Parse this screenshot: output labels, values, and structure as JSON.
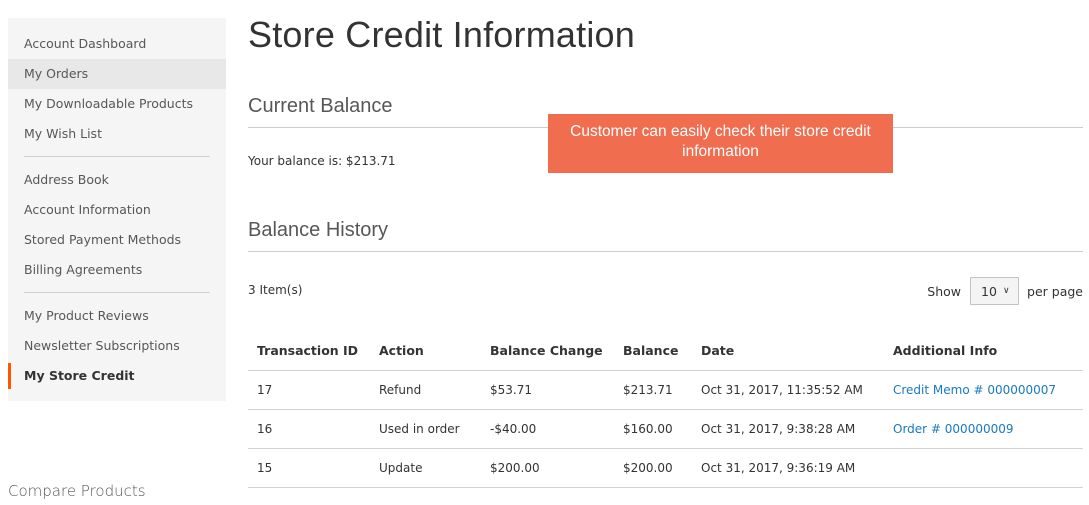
{
  "sidebar": {
    "groups": [
      {
        "items": [
          {
            "label": "Account Dashboard"
          },
          {
            "label": "My Orders"
          },
          {
            "label": "My Downloadable Products"
          },
          {
            "label": "My Wish List"
          }
        ]
      },
      {
        "items": [
          {
            "label": "Address Book"
          },
          {
            "label": "Account Information"
          },
          {
            "label": "Stored Payment Methods"
          },
          {
            "label": "Billing Agreements"
          }
        ]
      },
      {
        "items": [
          {
            "label": "My Product Reviews"
          },
          {
            "label": "Newsletter Subscriptions"
          },
          {
            "label": "My Store Credit"
          }
        ]
      }
    ],
    "hovered_item": "My Orders",
    "current_item": "My Store Credit",
    "accent_color": "#ff5501"
  },
  "compare": {
    "title": "Compare Products"
  },
  "page": {
    "title": "Store Credit Information"
  },
  "current_balance": {
    "title": "Current Balance",
    "text": "Your balance is: $213.71"
  },
  "callout": {
    "text": "Customer can easily check their store credit information",
    "color": "#f06d4f"
  },
  "history": {
    "title": "Balance History",
    "items_count": "3 Item(s)",
    "limiter": {
      "show_label": "Show",
      "selected": "10",
      "per_page_label": "per page"
    },
    "columns": [
      "Transaction ID",
      "Action",
      "Balance Change",
      "Balance",
      "Date",
      "Additional Info"
    ],
    "rows": [
      {
        "id": "17",
        "action": "Refund",
        "change": "$53.71",
        "change_type": "positive",
        "balance": "$213.71",
        "date": "Oct 31, 2017, 11:35:52 AM",
        "info": "Credit Memo # 000000007"
      },
      {
        "id": "16",
        "action": "Used in order",
        "change": "-$40.00",
        "change_type": "negative",
        "balance": "$160.00",
        "date": "Oct 31, 2017, 9:38:28 AM",
        "info": "Order # 000000009"
      },
      {
        "id": "15",
        "action": "Update",
        "change": "$200.00",
        "change_type": "positive",
        "balance": "$200.00",
        "date": "Oct 31, 2017, 9:36:19 AM",
        "info": ""
      }
    ],
    "colors": {
      "positive": "#3d9b35",
      "negative": "#e02b27",
      "link": "#1979c3"
    }
  }
}
